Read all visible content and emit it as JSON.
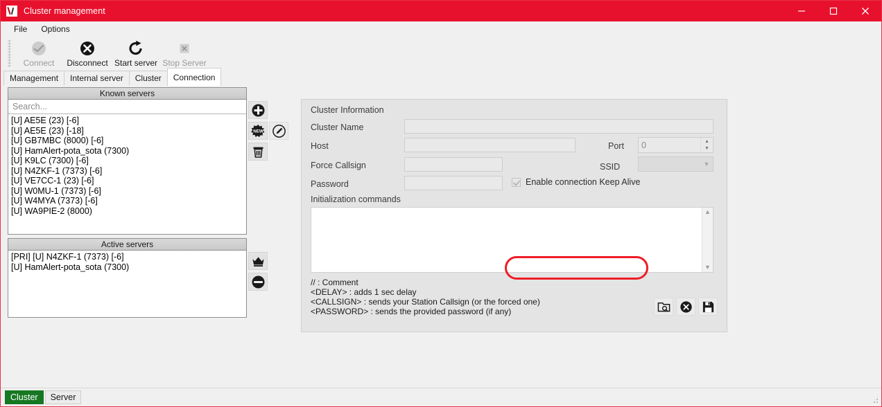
{
  "window": {
    "title": "Cluster management",
    "icon": "app-icon",
    "controls": [
      {
        "name": "minimize",
        "glyph": "minimize-icon"
      },
      {
        "name": "maximize",
        "glyph": "maximize-icon"
      },
      {
        "name": "close",
        "glyph": "close-icon"
      }
    ]
  },
  "menubar": {
    "items": [
      {
        "label": "File"
      },
      {
        "label": "Options"
      }
    ]
  },
  "toolbar": {
    "buttons": [
      {
        "label": "Connect",
        "icon": "connect-icon",
        "enabled": false
      },
      {
        "label": "Disconnect",
        "icon": "disconnect-icon",
        "enabled": true
      },
      {
        "label": "Start server",
        "icon": "start-server-icon",
        "enabled": true
      },
      {
        "label": "Stop Server",
        "icon": "stop-server-icon",
        "enabled": false
      }
    ]
  },
  "tabs": {
    "items": [
      {
        "label": "Management",
        "active": false
      },
      {
        "label": "Internal server",
        "active": false
      },
      {
        "label": "Cluster",
        "active": false
      },
      {
        "label": "Connection",
        "active": true
      }
    ]
  },
  "known_servers": {
    "header": "Known servers",
    "search_placeholder": "Search...",
    "search_value": "",
    "items": [
      "[U] AE5E (23) [-6]",
      "[U] AE5E (23) [-18]",
      "[U] GB7MBC (8000) [-6]",
      "[U] HamAlert-pota_sota (7300)",
      "[U] K9LC (7300) [-6]",
      "[U] N4ZKF-1 (7373) [-6]",
      "[U] VE7CC-1 (23) [-6]",
      "[U] W0MU-1 (7373) [-6]",
      "[U] W4MYA (7373) [-6]",
      "[U] WA9PIE-2 (8000)"
    ],
    "buttons": [
      {
        "name": "add-server-button",
        "icon": "plus-circle-icon"
      },
      {
        "name": "new-server-button",
        "icon": "new-badge-icon"
      },
      {
        "name": "edit-server-button",
        "icon": "pencil-circle-icon"
      },
      {
        "name": "delete-server-button",
        "icon": "trash-icon"
      }
    ]
  },
  "active_servers": {
    "header": "Active servers",
    "items": [
      "[PRI] [U] N4ZKF-1 (7373) [-6]",
      "[U] HamAlert-pota_sota (7300)"
    ],
    "buttons": [
      {
        "name": "set-primary-button",
        "icon": "crown-icon"
      },
      {
        "name": "remove-active-button",
        "icon": "minus-circle-icon"
      }
    ]
  },
  "cluster_information": {
    "title": "Cluster Information",
    "fields": {
      "cluster_name": {
        "label": "Cluster Name",
        "value": ""
      },
      "host": {
        "label": "Host",
        "value": ""
      },
      "port": {
        "label": "Port",
        "value": "0"
      },
      "force_callsign": {
        "label": "Force Callsign",
        "value": ""
      },
      "ssid": {
        "label": "SSID",
        "value": ""
      },
      "password": {
        "label": "Password",
        "value": ""
      }
    },
    "keep_alive": {
      "label": "Enable connection Keep Alive",
      "checked": true,
      "highlighted": true,
      "highlight_color": "#ee1c25"
    },
    "init_commands": {
      "label": "Initialization commands",
      "value": ""
    },
    "legend": [
      "// : Comment",
      "<DELAY> : adds 1 sec delay",
      "<CALLSIGN> : sends your Station Callsign (or the forced one)",
      "<PASSWORD> : sends the provided password (if any)"
    ],
    "actions": [
      {
        "name": "browse-button",
        "icon": "folder-search-icon"
      },
      {
        "name": "cancel-button",
        "icon": "x-circle-icon"
      },
      {
        "name": "save-button",
        "icon": "floppy-save-icon"
      }
    ]
  },
  "statusbar": {
    "chips": [
      {
        "label": "Cluster",
        "active": true,
        "color": "#167822"
      },
      {
        "label": "Server",
        "active": false
      }
    ]
  }
}
